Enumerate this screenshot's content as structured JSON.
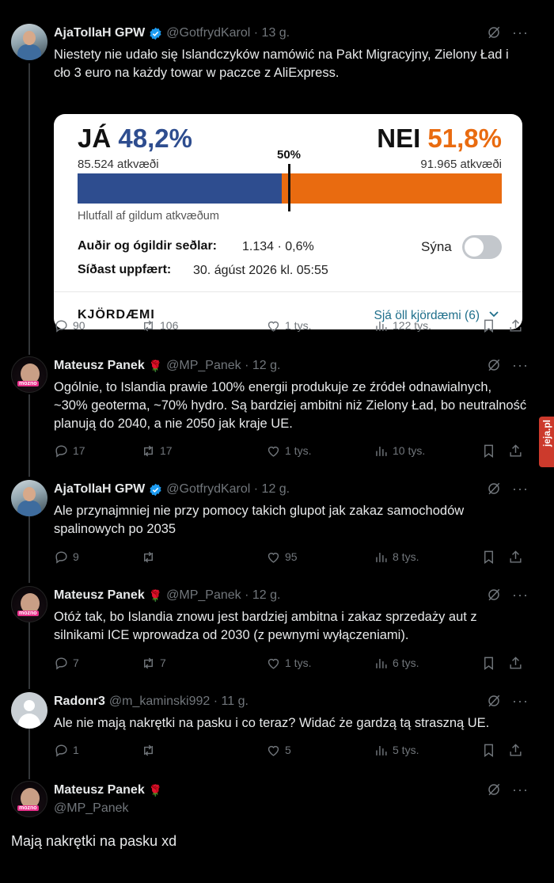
{
  "tweets": [
    {
      "name": "AjaTollaH GPW",
      "handle": "@GotfrydKarol · 13 g.",
      "text": "Niestety nie udało się Islandczyków namówić na Pakt Migracyjny, Zielony Ład i cło 3 euro na każdy towar w paczce z AliExpress.",
      "replies": "90",
      "reposts": "106",
      "likes": "1 tys.",
      "views": "122 tys."
    },
    {
      "name": "Mateusz Panek",
      "handle": "@MP_Panek · 12 g.",
      "text": "Ogólnie, to Islandia prawie 100% energii produkuje ze źródeł odnawialnych, ~30% geoterma, ~70% hydro. Są bardziej ambitni niż Zielony Ład, bo neutralność planują do 2040, a nie 2050 jak kraje UE.",
      "replies": "17",
      "reposts": "17",
      "likes": "1 tys.",
      "views": "10 tys."
    },
    {
      "name": "AjaTollaH GPW",
      "handle": "@GotfrydKarol · 12 g.",
      "text": "Ale przynajmniej nie przy pomocy takich glupot jak zakaz samochodów spalinowych po 2035",
      "replies": "9",
      "reposts": "",
      "likes": "95",
      "views": "8 tys."
    },
    {
      "name": "Mateusz Panek",
      "handle": "@MP_Panek · 12 g.",
      "text": "Otóż tak, bo Islandia znowu jest bardziej ambitna i zakaz sprzedaży aut z silnikami ICE wprowadza od 2030 (z pewnymi wyłączeniami).",
      "replies": "7",
      "reposts": "7",
      "likes": "1 tys.",
      "views": "6 tys."
    },
    {
      "name": "Radonr3",
      "handle": "@m_kaminski992 · 11 g.",
      "text": "Ale nie mają nakrętki na pasku i co teraz? Widać że gardzą tą straszną UE.",
      "replies": "1",
      "reposts": "",
      "likes": "5",
      "views": "5 tys."
    }
  ],
  "final": {
    "name": "Mateusz Panek",
    "handle": "@MP_Panek",
    "text": "Mają nakrętki na pasku xd"
  },
  "card": {
    "yes_label": "JÁ",
    "yes_pct": "48,2%",
    "yes_share": 0.482,
    "yes_votes": "85.524 atkvæði",
    "no_label": "NEI",
    "no_pct": "51,8%",
    "no_votes": "91.965 atkvæði",
    "midpoint": "50%",
    "ratio_caption": "Hlutfall af gildum atkvæðum",
    "invalid_label": "Auðir og ógildir seðlar:",
    "invalid_value": "1.134 · 0,6%",
    "show_label": "Sýna",
    "updated_label": "Síðast uppfært:",
    "updated_value": "30. ágúst 2026 kl. 05:55",
    "districts_label": "KJÖRDÆMI",
    "see_all": "Sjá öll kjördæmi (6)"
  },
  "watermark": "jeja.pl",
  "colors": {
    "yes": "#2e4d8f",
    "no": "#e96b10",
    "verified": "#1d9bf0",
    "background": "#000000"
  }
}
